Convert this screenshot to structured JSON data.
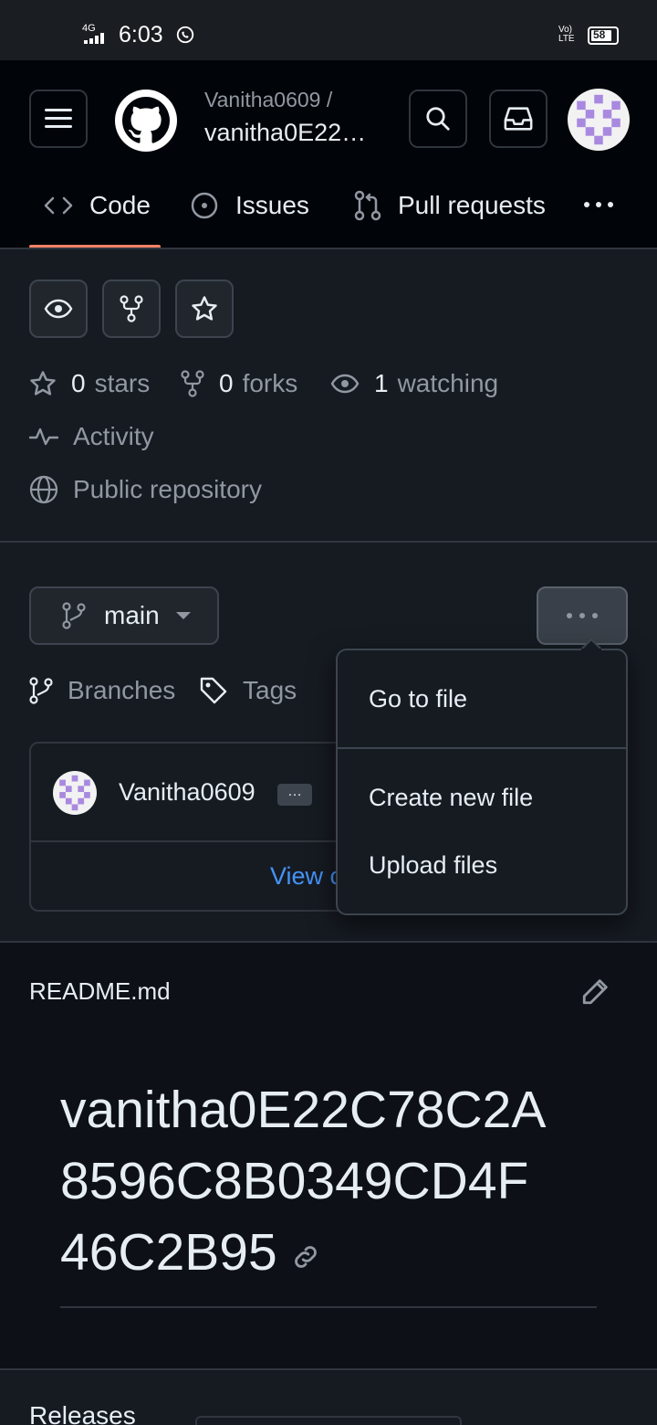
{
  "status_bar": {
    "network": "4G",
    "time": "6:03",
    "volte": "Vo) LTE",
    "battery": "58"
  },
  "header": {
    "owner": "Vanitha0609 /",
    "repo": "vanitha0E22…"
  },
  "tabs": [
    {
      "label": "Code",
      "icon": "code-icon",
      "active": true
    },
    {
      "label": "Issues",
      "icon": "issue-icon"
    },
    {
      "label": "Pull requests",
      "icon": "pull-request-icon"
    }
  ],
  "stats": {
    "stars_count": "0",
    "stars_label": "stars",
    "forks_count": "0",
    "forks_label": "forks",
    "watching_count": "1",
    "watching_label": "watching",
    "activity": "Activity",
    "visibility": "Public repository"
  },
  "branch": {
    "name": "main",
    "branches": "Branches",
    "tags": "Tags"
  },
  "commit": {
    "author": "Vanitha0609",
    "more": "…",
    "view_link": "View c"
  },
  "menu": {
    "items": [
      "Go to file",
      "Create new file",
      "Upload files"
    ]
  },
  "readme": {
    "filename": "README.md",
    "heading_line1": "vanitha0E22C78C2A",
    "heading_line2": "8596C8B0349CD4F",
    "heading_line3": "46C2B95"
  },
  "releases": {
    "title": "Releases"
  },
  "colors": {
    "accent": "#f78166",
    "link": "#4493f8",
    "bg": "#0d1117"
  }
}
